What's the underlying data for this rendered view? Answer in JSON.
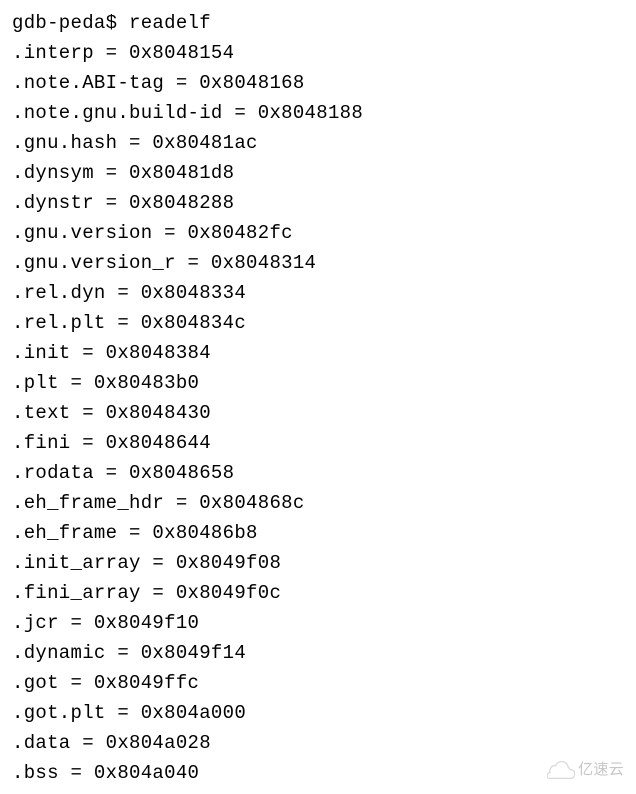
{
  "prompt": "gdb-peda$ ",
  "command": "readelf",
  "sections": [
    {
      "name": ".interp",
      "addr": "0x8048154"
    },
    {
      "name": ".note.ABI-tag",
      "addr": "0x8048168"
    },
    {
      "name": ".note.gnu.build-id",
      "addr": "0x8048188"
    },
    {
      "name": ".gnu.hash",
      "addr": "0x80481ac"
    },
    {
      "name": ".dynsym",
      "addr": "0x80481d8"
    },
    {
      "name": ".dynstr",
      "addr": "0x8048288"
    },
    {
      "name": ".gnu.version",
      "addr": "0x80482fc"
    },
    {
      "name": ".gnu.version_r",
      "addr": "0x8048314"
    },
    {
      "name": ".rel.dyn",
      "addr": "0x8048334"
    },
    {
      "name": ".rel.plt",
      "addr": "0x804834c"
    },
    {
      "name": ".init",
      "addr": "0x8048384"
    },
    {
      "name": ".plt",
      "addr": "0x80483b0"
    },
    {
      "name": ".text",
      "addr": "0x8048430"
    },
    {
      "name": ".fini",
      "addr": "0x8048644"
    },
    {
      "name": ".rodata",
      "addr": "0x8048658"
    },
    {
      "name": ".eh_frame_hdr",
      "addr": "0x804868c"
    },
    {
      "name": ".eh_frame",
      "addr": "0x80486b8"
    },
    {
      "name": ".init_array",
      "addr": "0x8049f08"
    },
    {
      "name": ".fini_array",
      "addr": "0x8049f0c"
    },
    {
      "name": ".jcr",
      "addr": "0x8049f10"
    },
    {
      "name": ".dynamic",
      "addr": "0x8049f14"
    },
    {
      "name": ".got",
      "addr": "0x8049ffc"
    },
    {
      "name": ".got.plt",
      "addr": "0x804a000"
    },
    {
      "name": ".data",
      "addr": "0x804a028"
    },
    {
      "name": ".bss",
      "addr": "0x804a040"
    }
  ],
  "watermark_text": "亿速云"
}
